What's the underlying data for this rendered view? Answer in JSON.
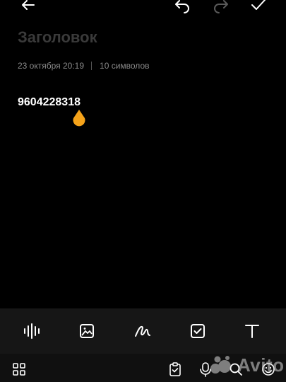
{
  "note": {
    "title_placeholder": "Заголовок",
    "date": "23 октября 20:19",
    "char_count": "10 символов",
    "content": "9604228318"
  },
  "topbar": {
    "icons": [
      "back-arrow-icon",
      "undo-icon",
      "redo-icon",
      "check-icon"
    ]
  },
  "toolbar": {
    "icons": [
      "audio-waveform-icon",
      "image-icon",
      "handwriting-icon",
      "checkbox-icon",
      "text-format-icon"
    ]
  },
  "navbar": {
    "icons": [
      "apps-grid-icon",
      "clipboard-icon",
      "microphone-icon",
      "search-icon",
      "emoji-icon"
    ]
  },
  "watermark": {
    "text": "Avito"
  },
  "colors": {
    "background": "#000000",
    "title": "#3a3a3a",
    "meta": "#8a8a8a",
    "accent": "#f5a31a",
    "toolbar_bg": "#161616"
  }
}
